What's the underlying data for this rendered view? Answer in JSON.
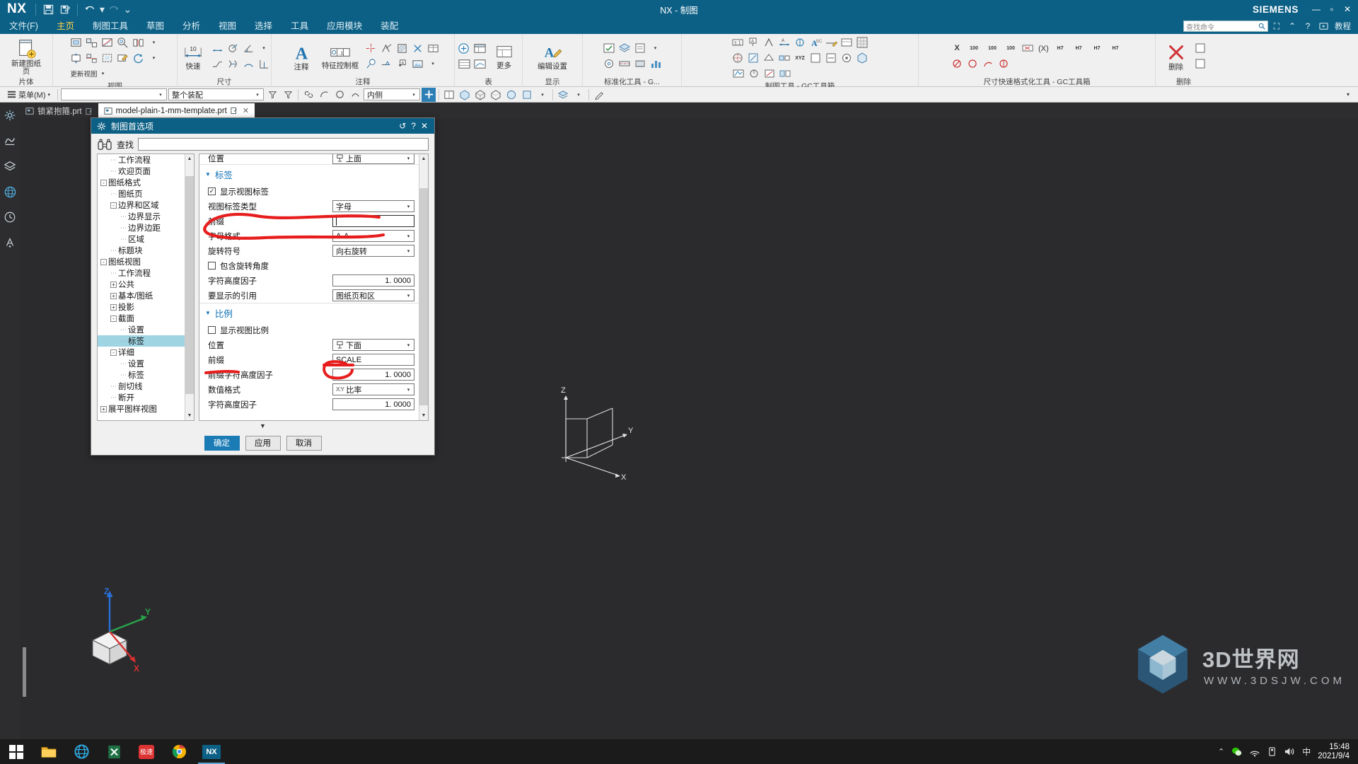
{
  "titlebar": {
    "app_logo": "NX",
    "window_title": "NX - 制图",
    "brand": "SIEMENS",
    "quick_icons": [
      "save-icon",
      "save-as-icon",
      "undo-icon",
      "redo-icon",
      "customize-qat-icon"
    ],
    "window_buttons": [
      "minimize",
      "maximize",
      "close"
    ]
  },
  "menubar": {
    "items": [
      {
        "label": "文件(F)",
        "active": false
      },
      {
        "label": "主页",
        "active": true
      },
      {
        "label": "制图工具",
        "active": false
      },
      {
        "label": "草图",
        "active": false
      },
      {
        "label": "分析",
        "active": false
      },
      {
        "label": "视图",
        "active": false
      },
      {
        "label": "选择",
        "active": false
      },
      {
        "label": "工具",
        "active": false
      },
      {
        "label": "应用模块",
        "active": false
      },
      {
        "label": "装配",
        "active": false
      }
    ],
    "search_placeholder": "查找命令",
    "help_label": "教程"
  },
  "ribbon": {
    "groups": [
      {
        "name": "片体",
        "label": "片体",
        "big": [
          {
            "label": "新建图纸页",
            "icon": "new-sheet-icon"
          }
        ]
      },
      {
        "name": "视图",
        "label": "视图",
        "big": []
      },
      {
        "name": "尺寸",
        "label": "尺寸",
        "big": [
          {
            "label": "快速",
            "icon": "quick-dimension-icon"
          }
        ]
      },
      {
        "name": "注释",
        "label": "注释",
        "big": [
          {
            "label": "注释",
            "icon": "annotation-icon"
          },
          {
            "label": "特征控制框",
            "icon": "feature-control-frame-icon"
          }
        ]
      },
      {
        "name": "表",
        "label": "表",
        "big": [
          {
            "label": "更多",
            "icon": "more-icon"
          }
        ]
      },
      {
        "name": "显示",
        "label": "显示",
        "big": [
          {
            "label": "编辑设置",
            "icon": "edit-settings-icon"
          }
        ]
      },
      {
        "name": "标准化工具",
        "label": "标准化工具 - G...",
        "big": []
      },
      {
        "name": "制图工具GC",
        "label": "制图工具 - GC工具箱",
        "big": []
      },
      {
        "name": "尺寸快速格式化工具",
        "label": "尺寸快速格式化工具 - GC工具箱",
        "big": []
      },
      {
        "name": "删除",
        "label": "删除",
        "big": [
          {
            "label": "删除",
            "icon": "delete-icon"
          }
        ]
      }
    ]
  },
  "toolbar2": {
    "menu_label": "菜单(M)",
    "combo1_value": "",
    "combo2_value": "整个装配",
    "combo3_value": "内侧"
  },
  "tabs": [
    {
      "label": "锁紧抱箍.prt",
      "active": false,
      "modified": true
    },
    {
      "label": "model-plain-1-mm-template.prt",
      "active": true,
      "modified": true
    }
  ],
  "dialog": {
    "title": "制图首选项",
    "title_icons": [
      "reset-icon",
      "help-icon",
      "close-icon"
    ],
    "find": {
      "label": "查找",
      "value": "",
      "placeholder": ""
    },
    "tree": [
      {
        "label": "工作流程",
        "depth": 2,
        "expander": null,
        "selected": false
      },
      {
        "label": "欢迎页面",
        "depth": 2,
        "expander": null,
        "selected": false
      },
      {
        "label": "图纸格式",
        "depth": 1,
        "expander": "-",
        "selected": false
      },
      {
        "label": "图纸页",
        "depth": 2,
        "expander": null,
        "selected": false
      },
      {
        "label": "边界和区域",
        "depth": 2,
        "expander": "-",
        "selected": false
      },
      {
        "label": "边界显示",
        "depth": 3,
        "expander": null,
        "selected": false
      },
      {
        "label": "边界边距",
        "depth": 3,
        "expander": null,
        "selected": false
      },
      {
        "label": "区域",
        "depth": 3,
        "expander": null,
        "selected": false
      },
      {
        "label": "标题块",
        "depth": 2,
        "expander": null,
        "selected": false
      },
      {
        "label": "图纸视图",
        "depth": 1,
        "expander": "-",
        "selected": false
      },
      {
        "label": "工作流程",
        "depth": 2,
        "expander": null,
        "selected": false
      },
      {
        "label": "公共",
        "depth": 2,
        "expander": "+",
        "selected": false
      },
      {
        "label": "基本/图纸",
        "depth": 2,
        "expander": "+",
        "selected": false
      },
      {
        "label": "投影",
        "depth": 2,
        "expander": "+",
        "selected": false
      },
      {
        "label": "截面",
        "depth": 2,
        "expander": "-",
        "selected": false
      },
      {
        "label": "设置",
        "depth": 3,
        "expander": null,
        "selected": false
      },
      {
        "label": "标签",
        "depth": 3,
        "expander": null,
        "selected": true
      },
      {
        "label": "详细",
        "depth": 2,
        "expander": "-",
        "selected": false
      },
      {
        "label": "设置",
        "depth": 3,
        "expander": null,
        "selected": false
      },
      {
        "label": "标签",
        "depth": 3,
        "expander": null,
        "selected": false
      },
      {
        "label": "剖切线",
        "depth": 2,
        "expander": null,
        "selected": false
      },
      {
        "label": "断开",
        "depth": 2,
        "expander": null,
        "selected": false
      },
      {
        "label": "展平图样视图",
        "depth": 1,
        "expander": "+",
        "selected": false
      }
    ],
    "options": {
      "clipped_top_row": {
        "label": "位置",
        "value": "上面",
        "icon": "position-icon"
      },
      "sections": [
        {
          "title": "标签",
          "expanded": true,
          "rows": [
            {
              "type": "checkbox",
              "label": "显示视图标签",
              "checked": true
            },
            {
              "type": "dropdown",
              "label": "视图标签类型",
              "value": "字母"
            },
            {
              "type": "text",
              "label": "前缀",
              "value": "",
              "focused": true,
              "annotated": true
            },
            {
              "type": "dropdown",
              "label": "字母格式",
              "value": "A-A"
            },
            {
              "type": "dropdown",
              "label": "旋转符号",
              "value": "向右旋转"
            },
            {
              "type": "checkbox",
              "label": "包含旋转角度",
              "checked": false
            },
            {
              "type": "number",
              "label": "字符高度因子",
              "value": "1. 0000"
            },
            {
              "type": "dropdown",
              "label": "要显示的引用",
              "value": "图纸页和区"
            }
          ]
        },
        {
          "title": "比例",
          "expanded": true,
          "rows": [
            {
              "type": "checkbox",
              "label": "显示视图比例",
              "checked": false
            },
            {
              "type": "dropdown",
              "label": "位置",
              "value": "下面",
              "icon": "position-icon"
            },
            {
              "type": "text",
              "label": "前缀",
              "value": "SCALE",
              "annotated": true
            },
            {
              "type": "number",
              "label": "前缀字符高度因子",
              "value": "1. 0000"
            },
            {
              "type": "dropdown",
              "label": "数值格式",
              "value": "比率",
              "icon": "xy-icon"
            },
            {
              "type": "number",
              "label": "字符高度因子",
              "value": "1. 0000"
            }
          ]
        }
      ]
    },
    "buttons": [
      {
        "label": "确定",
        "primary": true
      },
      {
        "label": "应用",
        "primary": false
      },
      {
        "label": "取消",
        "primary": false
      }
    ]
  },
  "graphics": {
    "wcs_axes": [
      "Z",
      "Y",
      "X"
    ],
    "model_axes": [
      "Z",
      "Y",
      "X"
    ]
  },
  "watermark": {
    "title": "3D世界网",
    "url": "WWW.3DSJW.COM"
  },
  "taskbar": {
    "apps": [
      "start-icon",
      "file-explorer-icon",
      "browser-icon",
      "excel-icon",
      "wechat-icon",
      "chrome-icon",
      "nx-icon"
    ],
    "nx_label": "NX",
    "app4_label": "极速",
    "tray_icons": [
      "chevron-up-icon",
      "wechat-tray-icon",
      "network-icon",
      "usb-icon",
      "volume-icon",
      "ime-icon"
    ],
    "ime_label": "中",
    "time": "15:48",
    "date": "2021/9/4"
  }
}
